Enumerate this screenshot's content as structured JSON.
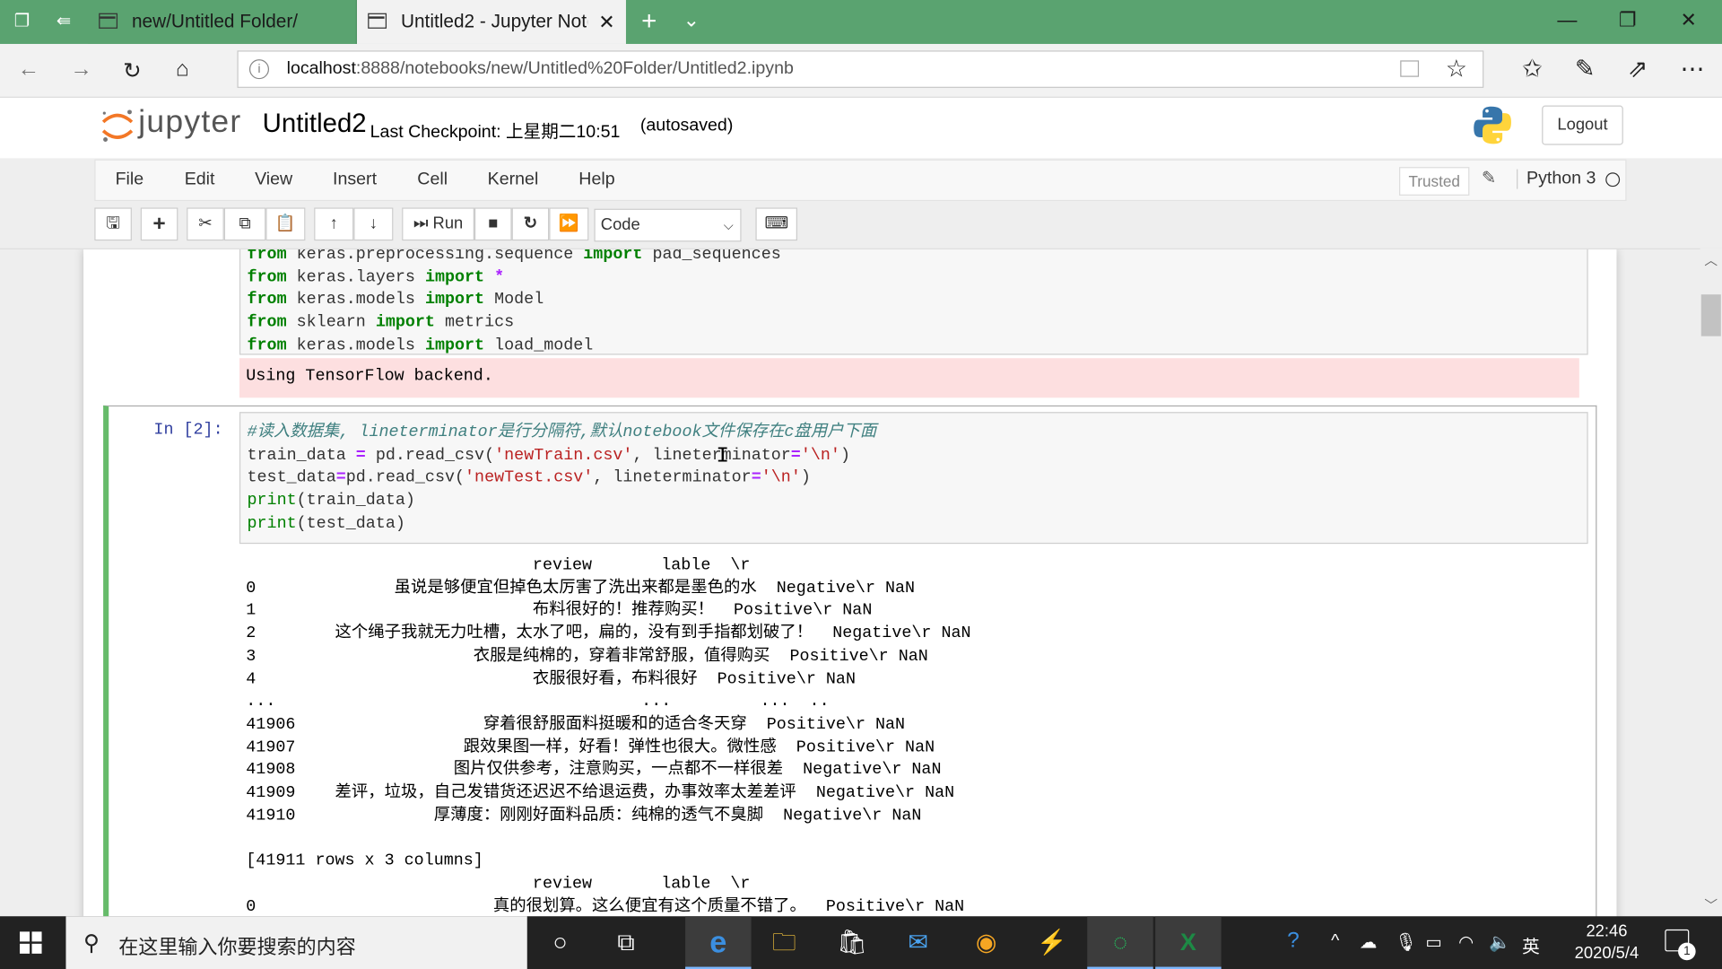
{
  "browser": {
    "tabs": [
      {
        "title": "new/Untitled Folder/"
      },
      {
        "title": "Untitled2 - Jupyter Note"
      }
    ],
    "url_host": "localhost",
    "url_rest": ":8888/notebooks/new/Untitled%20Folder/Untitled2.ipynb"
  },
  "jupyter": {
    "logo_text": "jupyter",
    "notebook_name": "Untitled2",
    "checkpoint": "Last Checkpoint: 上星期二10:51",
    "autosaved": "(autosaved)",
    "logout": "Logout",
    "menu": [
      "File",
      "Edit",
      "View",
      "Insert",
      "Cell",
      "Kernel",
      "Help"
    ],
    "trusted": "Trusted",
    "kernel": "Python 3",
    "run_label": "Run",
    "cell_type": "Code"
  },
  "cells": {
    "cell1_code": [
      "from keras.preprocessing.sequence import pad_sequences",
      "from keras.layers import *",
      "from keras.models import Model",
      "from sklearn import metrics",
      "from keras.models import load_model"
    ],
    "cell1_stderr": "Using TensorFlow backend.",
    "cell2_prompt": "In  [2]:",
    "cell2_code_lines": [
      "#读入数据集, lineterminator是行分隔符,默认notebook文件保存在c盘用户下面",
      "train_data = pd.read_csv('newTrain.csv', lineterminator='\\n')",
      "test_data=pd.read_csv('newTest.csv', lineterminator='\\n')",
      "print(train_data)",
      "print(test_data)"
    ],
    "cell2_output": [
      "                             review       lable  \\r",
      "0              虽说是够便宜但掉色太厉害了洗出来都是墨色的水  Negative\\r NaN",
      "1                            布料很好的！推荐购买！  Positive\\r NaN",
      "2        这个绳子我就无力吐槽，太水了吧，扁的，没有到手指都划破了！  Negative\\r NaN",
      "3                      衣服是纯棉的，穿着非常舒服，值得购买  Positive\\r NaN",
      "4                            衣服很好看，布料很好  Positive\\r NaN",
      "...                                     ...         ...  ..",
      "41906                   穿着很舒服面料挺暖和的适合冬天穿  Positive\\r NaN",
      "41907                 跟效果图一样，好看！弹性也很大。微性感  Positive\\r NaN",
      "41908                图片仅供参考，注意购买，一点都不一样很差  Negative\\r NaN",
      "41909    差评，垃圾，自己发错货还迟迟不给退运费，办事效率太差差评  Negative\\r NaN",
      "41910              厚薄度：刚刚好面料品质：纯棉的透气不臭脚  Negative\\r NaN",
      "",
      "[41911 rows x 3 columns]",
      "                             review       lable  \\r",
      "0                        真的很划算。这么便宜有这个质量不错了。  Positive\\r NaN"
    ]
  },
  "taskbar": {
    "search_placeholder": "在这里输入你要搜索的内容",
    "ime": "英",
    "time": "22:46",
    "date": "2020/5/4",
    "notif_count": "1"
  }
}
